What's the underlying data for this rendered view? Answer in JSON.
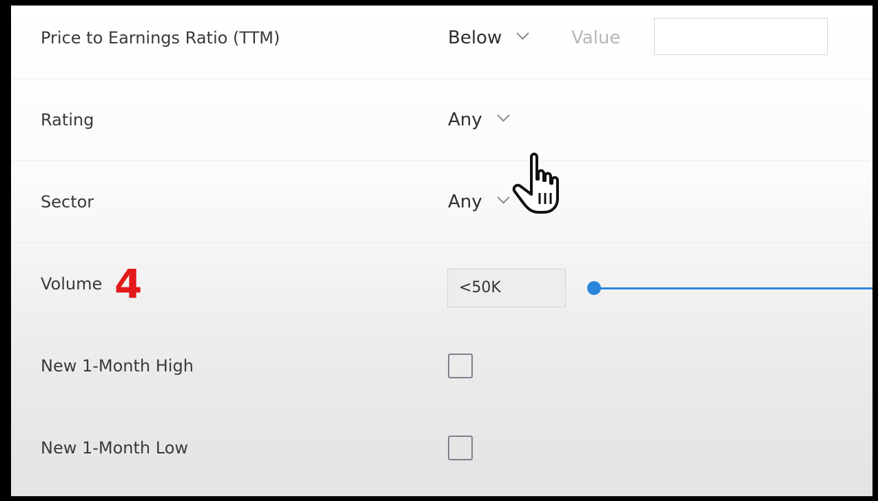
{
  "filters": {
    "pe": {
      "label": "Price to Earnings Ratio (TTM)",
      "condition": "Below",
      "value_label": "Value",
      "value": ""
    },
    "rating": {
      "label": "Rating",
      "value": "Any"
    },
    "sector": {
      "label": "Sector",
      "value": "Any"
    },
    "volume": {
      "label": "Volume",
      "annotation": "4",
      "value": "<50K"
    },
    "new_month_high": {
      "label": "New 1-Month High",
      "checked": false
    },
    "new_month_low": {
      "label": "New 1-Month Low",
      "checked": false
    }
  },
  "colors": {
    "annotation": "#e21a1a",
    "slider": "#2b86db"
  },
  "icons": {
    "dropdown": "chevron-down-icon",
    "cursor": "hand-pointer-icon"
  }
}
